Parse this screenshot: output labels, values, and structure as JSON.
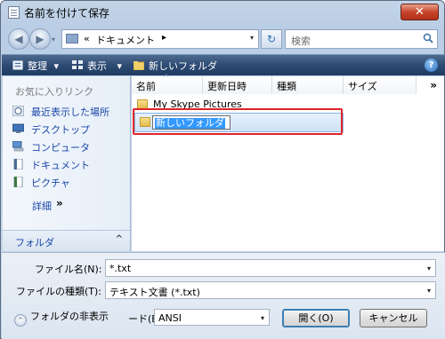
{
  "window": {
    "title": "名前を付けて保存",
    "close_glyph": "✕"
  },
  "address": {
    "back_glyph": "◀",
    "forward_glyph": "▶",
    "dropdown_glyph": "▾",
    "path_prefix": "«",
    "path_segment": "ドキュメント",
    "path_arrow": "▸",
    "refresh_glyph": "↻",
    "search_placeholder": "検索"
  },
  "toolbar": {
    "organize_label": "整理",
    "views_label": "表示",
    "new_folder_label": "新しいフォルダ",
    "dropdown_glyph": "▾",
    "help_glyph": "?"
  },
  "sidebar": {
    "favorites_header": "お気に入りリンク",
    "items": [
      {
        "label": "最近表示した場所",
        "icon": "recent-places-icon"
      },
      {
        "label": "デスクトップ",
        "icon": "desktop-icon"
      },
      {
        "label": "コンピュータ",
        "icon": "computer-icon"
      },
      {
        "label": "ドキュメント",
        "icon": "documents-icon"
      },
      {
        "label": "ピクチャ",
        "icon": "pictures-icon"
      }
    ],
    "details_label": "詳細",
    "details_chevron": "»",
    "folders_label": "フォルダ",
    "folders_toggle": "^"
  },
  "file_list": {
    "columns": [
      "名前",
      "更新日時",
      "種類",
      "サイズ"
    ],
    "more_columns_glyph": "»",
    "sort_indicator": "^",
    "items": [
      {
        "name": "My Skype Pictures",
        "icon": "folder-icon"
      }
    ],
    "new_folder_name": "新しいフォルダ"
  },
  "form": {
    "filename_label": "ファイル名(N):",
    "filename_value": "*.txt",
    "filetype_label": "ファイルの種類(T):",
    "filetype_value": "テキスト文書 (*.txt)",
    "hide_folders_label": "フォルダの非表示",
    "encoding_label": "ード(E):",
    "encoding_value": "ANSI",
    "open_button": "開く(O)",
    "cancel_button": "キャンセル"
  },
  "colors": {
    "toolbar": "#2d4b73",
    "highlight": "#e0232b",
    "selection": "#3399ff"
  }
}
